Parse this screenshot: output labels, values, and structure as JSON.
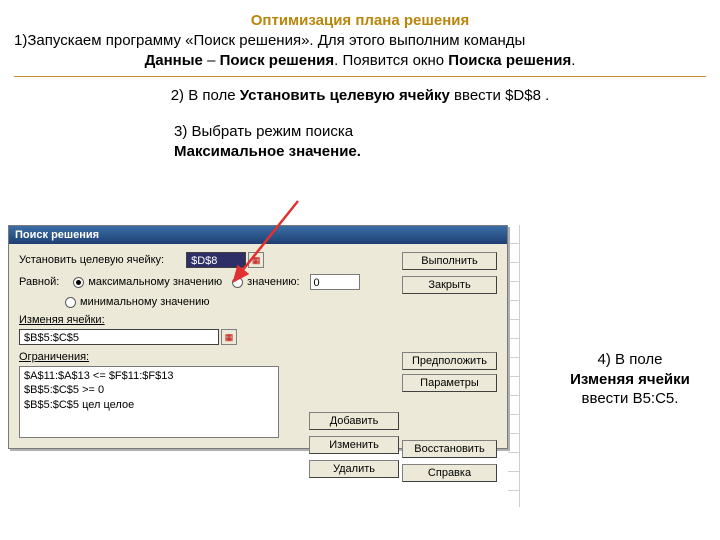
{
  "title": "Оптимизация плана решения",
  "intro": {
    "row1_pre": "1)Запускаем программу «Поиск решения». Для этого выполним команды",
    "row2_b1": "Данные",
    "row2_mid": " – ",
    "row2_b2": "Поиск решения",
    "row2_tail": ". Появится окно ",
    "row2_b3": "Поиска решения",
    "row2_end": "."
  },
  "step2": {
    "pre": "2) В поле ",
    "bold": "Установить целевую ячейку",
    "post": "  ввести  $D$8 ."
  },
  "step3": {
    "line1": "3) Выбрать режим поиска",
    "bullet_marker": "",
    "bullet_bold": "Максимальное значение."
  },
  "side": {
    "l1": "4) В поле",
    "bold": "Изменяя ячейки",
    "l3": "ввести B5:C5."
  },
  "dialog": {
    "title": "Поиск решения",
    "target_label": "Установить целевую ячейку:",
    "target_value": "$D$8",
    "equal": "Равной:",
    "opt_max": "максимальному значению",
    "opt_val": "значению:",
    "val_num": "0",
    "opt_min": "минимальному значению",
    "changing_lbl": "Изменяя ячейки:",
    "changing_val": "$B$5:$C$5",
    "constraints_lbl": "Ограничения:",
    "constraints": [
      "$A$11:$A$13 <= $F$11:$F$13",
      "$B$5:$C$5 >= 0",
      "$B$5:$C$5 цел целое"
    ],
    "buttons": {
      "run": "Выполнить",
      "close": "Закрыть",
      "guess": "Предположить",
      "options": "Параметры",
      "add": "Добавить",
      "edit": "Изменить",
      "del": "Удалить",
      "reset": "Восстановить",
      "help": "Справка"
    }
  }
}
